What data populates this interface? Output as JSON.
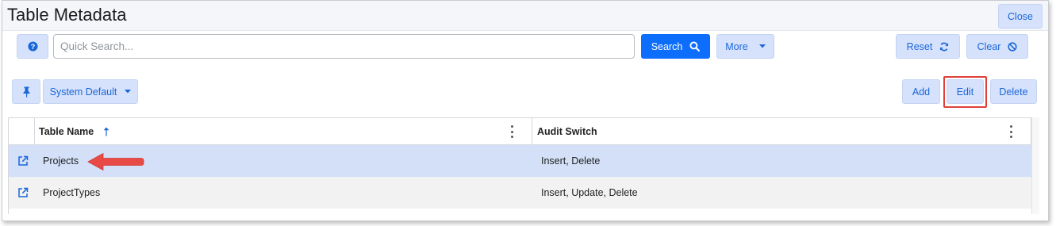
{
  "page": {
    "title": "Table Metadata",
    "close_label": "Close"
  },
  "search": {
    "placeholder": "Quick Search...",
    "value": "",
    "button_label": "Search"
  },
  "toolbar": {
    "more_label": "More",
    "reset_label": "Reset",
    "clear_label": "Clear",
    "view_label": "System Default",
    "add_label": "Add",
    "edit_label": "Edit",
    "delete_label": "Delete"
  },
  "grid": {
    "columns": [
      {
        "label": "Table Name",
        "sort": "ascending"
      },
      {
        "label": "Audit Switch"
      }
    ],
    "rows": [
      {
        "table_name": "Projects",
        "audit_switch": "Insert, Delete",
        "selected": true
      },
      {
        "table_name": "ProjectTypes",
        "audit_switch": "Insert, Update, Delete",
        "selected": false
      }
    ]
  },
  "colors": {
    "primary": "#0d6efd",
    "button_bg": "#d6e2fb",
    "button_text": "#1a66d9",
    "selected_row": "#d3e0f8",
    "highlight_box": "#e0403a",
    "annotation_arrow": "#e84a45"
  }
}
